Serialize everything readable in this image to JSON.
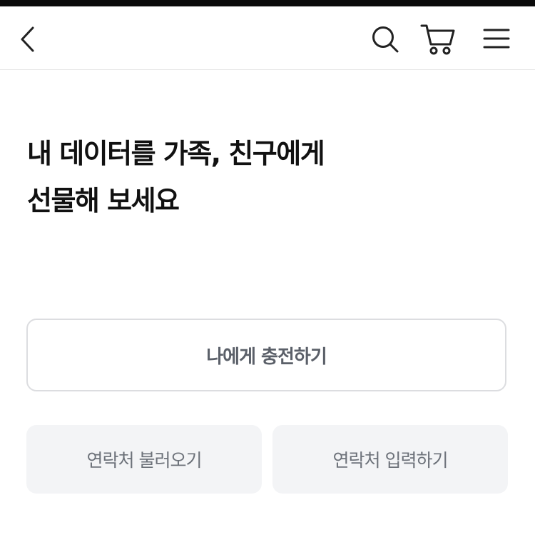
{
  "header": {
    "icons": {
      "back": "chevron-left-icon",
      "search": "search-icon",
      "cart": "cart-icon",
      "menu": "hamburger-menu-icon"
    }
  },
  "main": {
    "headline_line1": "내 데이터를 가족, 친구에게",
    "headline_line2": "선물해 보세요",
    "charge_self_label": "나에게 충전하기",
    "load_contacts_label": "연락처 불러오기",
    "enter_contact_label": "연락처 입력하기"
  },
  "colors": {
    "primary_text": "#111111",
    "button_border": "#dcdde0",
    "button_text": "#5b6069",
    "secondary_bg": "#f3f4f6",
    "secondary_text": "#6d727a"
  }
}
